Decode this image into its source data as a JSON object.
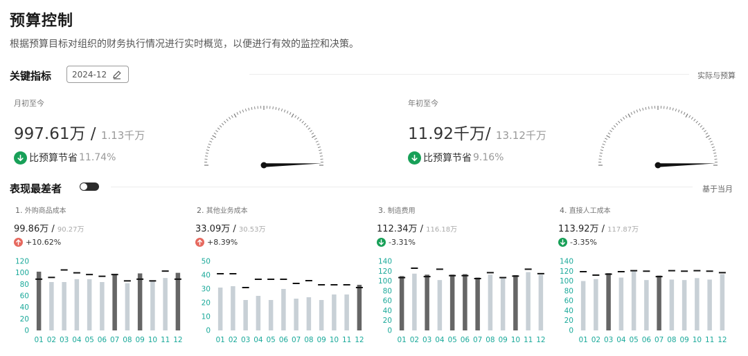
{
  "header": {
    "title": "预算控制",
    "subtitle": "根据预算目标对组织的财务执行情况进行实时概览，以便进行有效的监控和决策。"
  },
  "key_metrics": {
    "heading": "关键指标",
    "date": "2024-12",
    "right_label": "实际与预算",
    "mtd": {
      "label": "月初至今",
      "actual": "997.61万",
      "sep": " / ",
      "budget": "1.13千万",
      "save_label": "比预算节省",
      "save_pct": "11.74%",
      "gauge_fraction": 0.99
    },
    "ytd": {
      "label": "年初至今",
      "actual": "11.92千万",
      "sep": "/ ",
      "budget": "13.12千万",
      "save_label": "比预算节省",
      "save_pct": "9.16%",
      "gauge_fraction": 0.99
    }
  },
  "worst": {
    "heading": "表现最差者",
    "right_label": "基于当月",
    "toggle_on": true,
    "cards": [
      {
        "num": "1.",
        "name": "外购商品成本",
        "actual": "99.86万",
        "sep": " / ",
        "budget": "90.27万",
        "change": "+10.62%",
        "direction": "up"
      },
      {
        "num": "2.",
        "name": "其他业务成本",
        "actual": "33.09万",
        "sep": " / ",
        "budget": "30.53万",
        "change": "+8.39%",
        "direction": "up"
      },
      {
        "num": "3.",
        "name": "制造费用",
        "actual": "112.34万",
        "sep": " / ",
        "budget": "116.18万",
        "change": "-3.31%",
        "direction": "down"
      },
      {
        "num": "4.",
        "name": "直接人工成本",
        "actual": "113.92万",
        "sep": " / ",
        "budget": "117.87万",
        "change": "-3.35%",
        "direction": "down"
      }
    ]
  },
  "colors": {
    "bar_over": "#666666",
    "bar_under": "#c8d0d6",
    "budget_mark": "#111111",
    "axis_text": "#1aa99a",
    "up": "#e6695f",
    "down": "#18a058"
  },
  "chart_data": [
    {
      "type": "bar",
      "categories": [
        "01",
        "02",
        "03",
        "04",
        "05",
        "06",
        "07",
        "08",
        "09",
        "10",
        "11",
        "12"
      ],
      "series": [
        {
          "name": "",
          "values": [
            102,
            84,
            84,
            89,
            89,
            84,
            98,
            82,
            99,
            86,
            91,
            100
          ]
        },
        {
          "name": "",
          "values": [
            89,
            92,
            105,
            100,
            97,
            94,
            97,
            86,
            89,
            86,
            103,
            89
          ]
        }
      ],
      "ylim": [
        0,
        120
      ],
      "yticks": [
        0,
        20,
        40,
        60,
        80,
        100,
        120
      ]
    },
    {
      "type": "bar",
      "categories": [
        "01",
        "02",
        "03",
        "04",
        "05",
        "06",
        "07",
        "08",
        "09",
        "10",
        "11",
        "12"
      ],
      "series": [
        {
          "name": "",
          "values": [
            31,
            32,
            22,
            25,
            22,
            30,
            23,
            24,
            22,
            26,
            26,
            33
          ]
        },
        {
          "name": "",
          "values": [
            41,
            41,
            31,
            37,
            37,
            37,
            34,
            36,
            33,
            33,
            33,
            31
          ]
        }
      ],
      "ylim": [
        0,
        50
      ],
      "yticks": [
        0,
        10,
        20,
        30,
        40,
        50
      ]
    },
    {
      "type": "bar",
      "categories": [
        "01",
        "02",
        "03",
        "04",
        "05",
        "06",
        "07",
        "08",
        "09",
        "10",
        "11",
        "12"
      ],
      "series": [
        {
          "name": "",
          "values": [
            110,
            115,
            113,
            102,
            113,
            114,
            107,
            113,
            107,
            112,
            118,
            113
          ]
        },
        {
          "name": "",
          "values": [
            107,
            126,
            109,
            124,
            111,
            111,
            105,
            117,
            107,
            110,
            124,
            115
          ]
        }
      ],
      "ylim": [
        0,
        140
      ],
      "yticks": [
        0,
        20,
        40,
        60,
        80,
        100,
        120,
        140
      ]
    },
    {
      "type": "bar",
      "categories": [
        "01",
        "02",
        "03",
        "04",
        "05",
        "06",
        "07",
        "08",
        "09",
        "10",
        "11",
        "12"
      ],
      "series": [
        {
          "name": "",
          "values": [
            100,
            104,
            116,
            107,
            121,
            102,
            111,
            103,
            102,
            106,
            103,
            114
          ]
        },
        {
          "name": "",
          "values": [
            119,
            112,
            114,
            119,
            121,
            120,
            109,
            121,
            120,
            121,
            120,
            117
          ]
        }
      ],
      "ylim": [
        0,
        140
      ],
      "yticks": [
        0,
        20,
        40,
        60,
        80,
        100,
        120,
        140
      ]
    }
  ]
}
